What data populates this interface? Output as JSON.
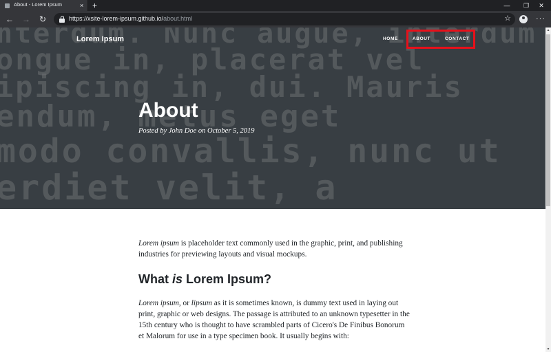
{
  "browser": {
    "tab_title": "About - Lorem Ipsum",
    "tab_close": "×",
    "new_tab": "+",
    "url_host": "https://xsite-lorem-ipsum.github.io/",
    "url_path": "about.html",
    "back_icon": "arrow-left-icon",
    "forward_icon": "arrow-right-icon",
    "refresh_icon": "refresh-icon",
    "lock_icon": "lock-icon",
    "bookmark_icon": "star-icon",
    "profile_icon": "avatar-icon",
    "menu_icon": "more-icon"
  },
  "site": {
    "brand": "Lorem Ipsum",
    "nav": [
      "HOME",
      "ABOUT",
      "CONTACT"
    ],
    "highlight_color": "#e8101a"
  },
  "hero": {
    "title": "About",
    "meta": "Posted by John Doe on October 5, 2019",
    "background_lines": [
      "nterdum. Nunc augue, interdum",
      "ongue in, placerat vel",
      "ipiscing in, dui. Mauris",
      "endum, metus eget",
      "modo convallis, nunc ut",
      "erdiet velit, a"
    ]
  },
  "content": {
    "p1_em": "Lorem ipsum",
    "p1_rest": " is placeholder text commonly used in the graphic, print, and publishing industries for previewing layouts and visual mockups.",
    "h2_before": "What ",
    "h2_em": "is",
    "h2_after": " Lorem Ipsum?",
    "p2_em1": "Lorem ipsum",
    "p2_mid": ", or ",
    "p2_em2": "lipsum",
    "p2_rest": " as it is sometimes known, is dummy text used in laying out print, graphic or web designs. The passage is attributed to an unknown typesetter in the 15th century who is thought to have scrambled parts of Cicero's De Finibus Bonorum et Malorum for use in a type specimen book. It usually begins with:"
  }
}
